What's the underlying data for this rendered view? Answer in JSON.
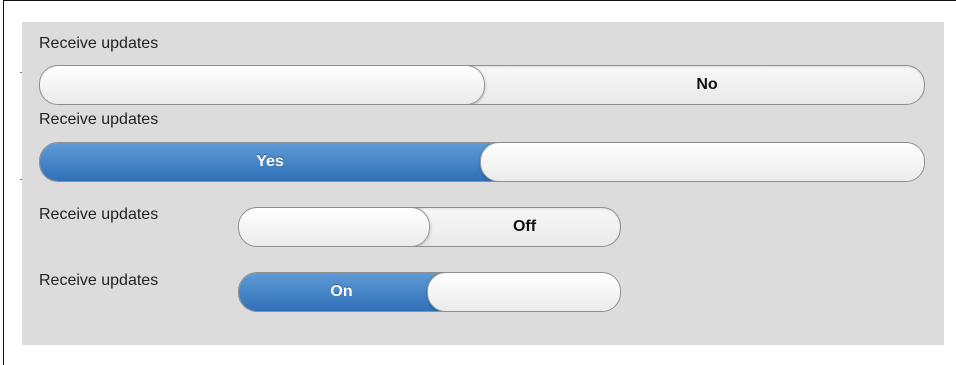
{
  "controls": [
    {
      "label": "Receive updates",
      "state": "off",
      "state_text": "No"
    },
    {
      "label": "Receive updates",
      "state": "on",
      "state_text": "Yes"
    },
    {
      "label": "Receive updates",
      "state": "off",
      "state_text": "Off"
    },
    {
      "label": "Receive updates",
      "state": "on",
      "state_text": "On"
    }
  ],
  "colors": {
    "panel_background": "#dcdcdc",
    "active_blue": "#3a7bc8",
    "track_light": "#f2f2f2"
  }
}
